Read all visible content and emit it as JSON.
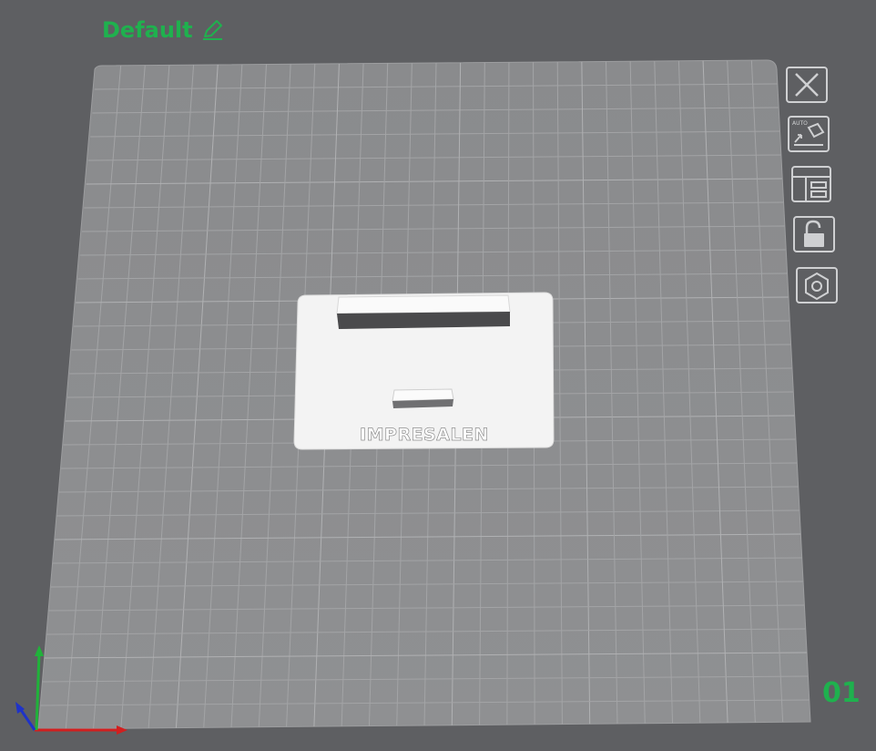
{
  "plate": {
    "name": "Default",
    "number": "01"
  },
  "model": {
    "embossed_text": "IMPRESALEN"
  },
  "toolbar": {
    "close_icon": "close-icon",
    "auto_orient_icon": "auto-orient-icon",
    "auto_orient_badge": "AUTO",
    "arrange_icon": "arrange-layout-icon",
    "lock_icon": "unlock-icon",
    "settings_icon": "plate-settings-hex-icon"
  },
  "colors": {
    "background": "#5e5f62",
    "bed": "#8c8d8f",
    "grid": "#a4a5a7",
    "accent_green": "#1fb14e",
    "axis_x": "#d11f1f",
    "axis_y": "#20b23a",
    "axis_z": "#1f33c8",
    "model": "#f4f4f4"
  }
}
